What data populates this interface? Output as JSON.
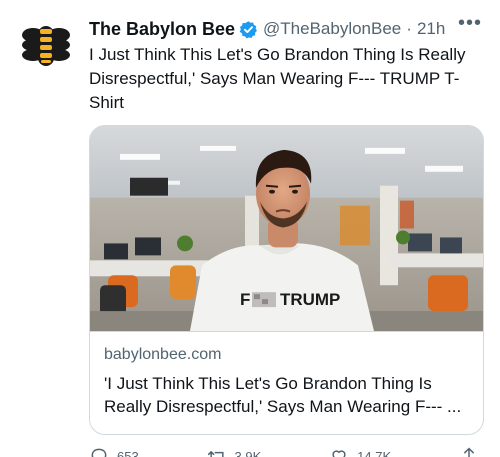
{
  "tweet": {
    "display_name": "The Babylon Bee",
    "handle": "@TheBabylonBee",
    "separator": "·",
    "time": "21h",
    "more_label": "•••",
    "text": "I Just Think This Let's Go Brandon Thing Is Really Disrespectful,' Says Man Wearing F--- TRUMP T-Shirt",
    "verified_color": "#1d9bf0",
    "avatar_icon": "bee-logo-icon"
  },
  "card": {
    "domain": "babylonbee.com",
    "title": "'I Just Think This Let's Go Brandon Thing Is Really Disrespectful,' Says Man Wearing F--- ...",
    "shirt_text_visible": "TRUMP",
    "shirt_text_prefix": "F"
  },
  "actions": {
    "reply_count": "653",
    "retweet_count": "3.9K",
    "like_count": "14.7K",
    "reply_icon": "reply-icon",
    "retweet_icon": "retweet-icon",
    "like_icon": "heart-icon",
    "share_icon": "share-icon"
  },
  "colors": {
    "text_primary": "#0f1419",
    "text_secondary": "#536471",
    "border": "#cfd9de",
    "accent": "#1d9bf0",
    "bee_yellow": "#f5b324"
  }
}
